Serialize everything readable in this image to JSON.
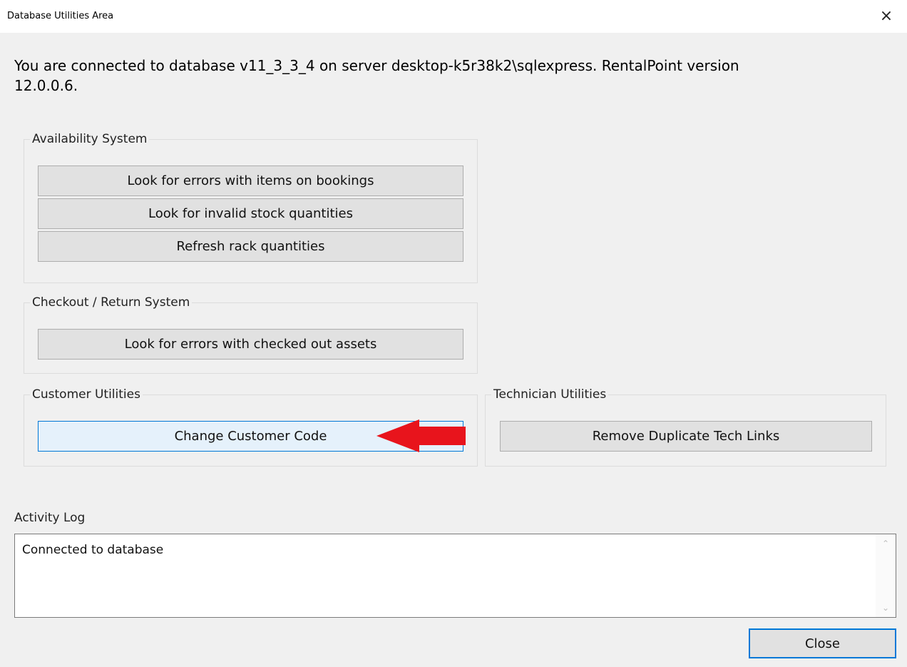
{
  "window": {
    "title": "Database Utilities Area",
    "close_icon": "×"
  },
  "connection_info": "You are connected to database v11_3_3_4 on server desktop-k5r38k2\\sqlexpress. RentalPoint version 12.0.0.6.",
  "groups": {
    "availability": {
      "label": "Availability System",
      "buttons": [
        "Look for errors with items on bookings",
        "Look for invalid stock quantities",
        "Refresh rack quantities"
      ]
    },
    "checkout": {
      "label": "Checkout / Return System",
      "buttons": [
        "Look for errors with checked out assets"
      ]
    },
    "customer": {
      "label": "Customer Utilities",
      "buttons": [
        "Change Customer Code"
      ]
    },
    "technician": {
      "label": "Technician Utilities",
      "buttons": [
        "Remove Duplicate Tech Links"
      ]
    }
  },
  "activity_log": {
    "label": "Activity Log",
    "text": "Connected to database"
  },
  "footer": {
    "close_label": "Close"
  },
  "annotation": {
    "arrow_color": "#e8141c",
    "icon": "red-arrow-icon"
  }
}
